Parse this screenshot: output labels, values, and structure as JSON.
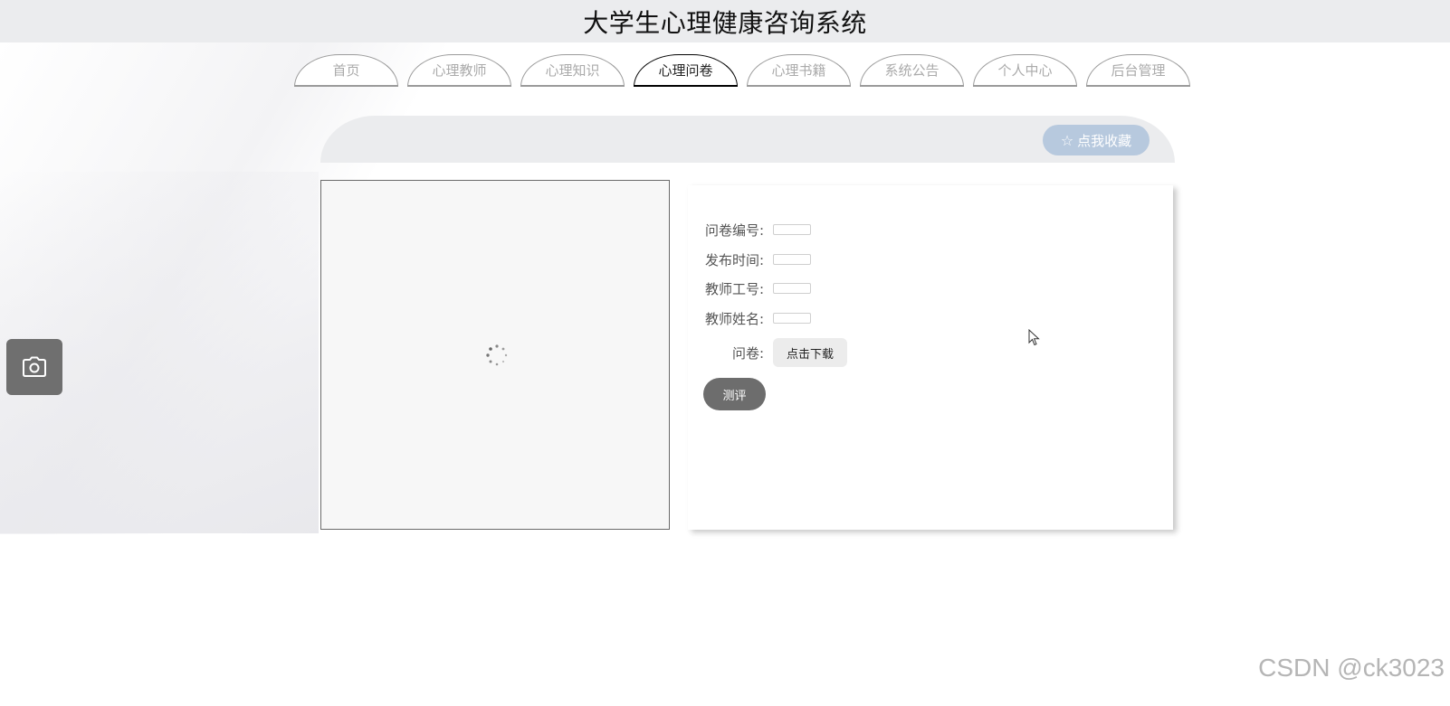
{
  "header": {
    "title": "大学生心理健康咨询系统"
  },
  "nav": {
    "tabs": [
      {
        "label": "首页",
        "active": false
      },
      {
        "label": "心理教师",
        "active": false
      },
      {
        "label": "心理知识",
        "active": false
      },
      {
        "label": "心理问卷",
        "active": true
      },
      {
        "label": "心理书籍",
        "active": false
      },
      {
        "label": "系统公告",
        "active": false
      },
      {
        "label": "个人中心",
        "active": false
      },
      {
        "label": "后台管理",
        "active": false
      }
    ]
  },
  "actions": {
    "favorite_label": "点我收藏",
    "favorite_icon": "star-outline-icon"
  },
  "detail": {
    "fields": [
      {
        "label": "问卷编号:",
        "value": ""
      },
      {
        "label": "发布时间:",
        "value": ""
      },
      {
        "label": "教师工号:",
        "value": ""
      },
      {
        "label": "教师姓名:",
        "value": ""
      }
    ],
    "questionnaire_label": "问卷:",
    "download_label": "点击下载",
    "evaluate_label": "测评"
  },
  "floating": {
    "camera_icon": "camera-icon"
  },
  "watermark": "CSDN @ck3023",
  "colors": {
    "header_bg": "#ebecee",
    "favorite_bg": "#b7c9de",
    "evaluate_bg": "#6d6d6d",
    "camera_bg": "#6f6f6f"
  }
}
